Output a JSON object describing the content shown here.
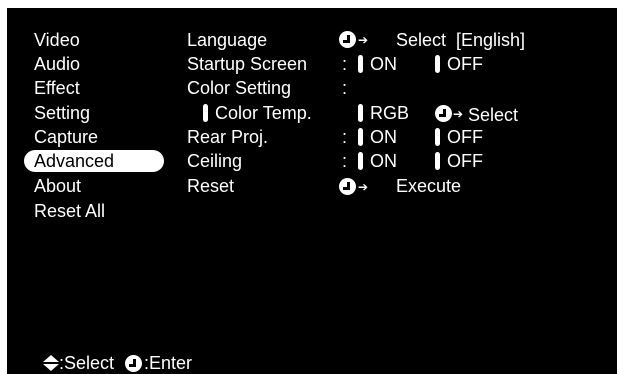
{
  "menu": {
    "items": [
      {
        "label": "Video"
      },
      {
        "label": "Audio"
      },
      {
        "label": "Effect"
      },
      {
        "label": "Setting"
      },
      {
        "label": "Capture"
      },
      {
        "label": "Advanced",
        "selected": true
      },
      {
        "label": "About"
      },
      {
        "label": "Reset All"
      }
    ]
  },
  "params": {
    "language": {
      "label": "Language",
      "action": "Select",
      "value": "[English]"
    },
    "startup_screen": {
      "label": "Startup Screen",
      "on": "ON",
      "off": "OFF",
      "colon": ":"
    },
    "color_setting": {
      "label": "Color Setting",
      "colon": ":"
    },
    "color_temp": {
      "label": "Color Temp.",
      "rgb": "RGB",
      "action": "Select"
    },
    "rear_proj": {
      "label": "Rear Proj.",
      "on": "ON",
      "off": "OFF",
      "colon": ":"
    },
    "ceiling": {
      "label": "Ceiling",
      "on": "ON",
      "off": "OFF",
      "colon": ":"
    },
    "reset": {
      "label": "Reset",
      "action": "Execute"
    }
  },
  "footer": {
    "select_label": ":Select",
    "enter_label": ":Enter"
  },
  "colors": {
    "background": "#000000",
    "text": "#ffffff",
    "highlight": "#ffffff",
    "highlight_text": "#000000"
  }
}
